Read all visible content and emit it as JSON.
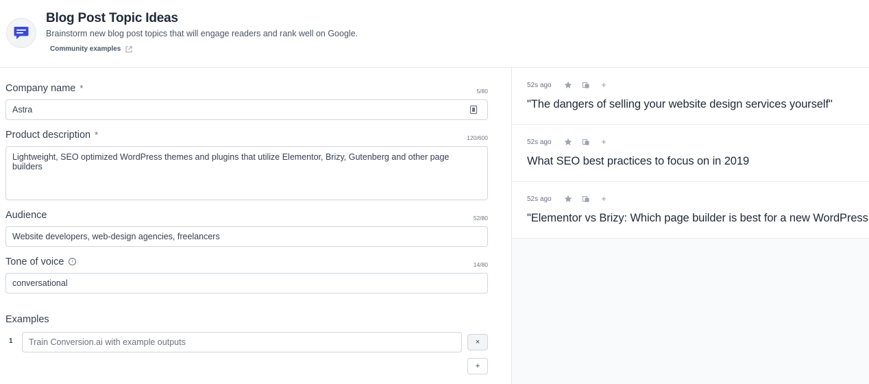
{
  "header": {
    "title": "Blog Post Topic Ideas",
    "subtitle": "Brainstorm new blog post topics that will engage readers and rank well on Google.",
    "community_link": "Community examples",
    "app_icon": "chat-bubble-icon"
  },
  "form": {
    "company_name": {
      "label": "Company name",
      "required": "*",
      "counter": "5/80",
      "value": "Astra"
    },
    "product_description": {
      "label": "Product description",
      "required": "*",
      "counter": "120/600",
      "value": "Lightweight, SEO optimized WordPress themes and plugins that utilize Elementor, Brizy, Gutenberg and other page builders"
    },
    "audience": {
      "label": "Audience",
      "counter": "52/80",
      "value": "Website developers, web-design agencies, freelancers"
    },
    "tone": {
      "label": "Tone of voice",
      "counter": "14/80",
      "value": "conversational",
      "info_icon": "info-icon"
    },
    "examples": {
      "label": "Examples",
      "index": "1",
      "placeholder": "Train Conversion.ai with example outputs",
      "remove_label": "×",
      "add_label": "+"
    }
  },
  "results": [
    {
      "time": "52s ago",
      "text": "\"The dangers of selling your website design services yourself\""
    },
    {
      "time": "52s ago",
      "text": "What SEO best practices to focus on in 2019"
    },
    {
      "time": "52s ago",
      "text": "\"Elementor vs Brizy: Which page builder is best for a new WordPress user?\""
    }
  ],
  "colors": {
    "accent": "#3b4bd8",
    "border": "#d1d5db",
    "panel_bg": "#f9fafb"
  }
}
